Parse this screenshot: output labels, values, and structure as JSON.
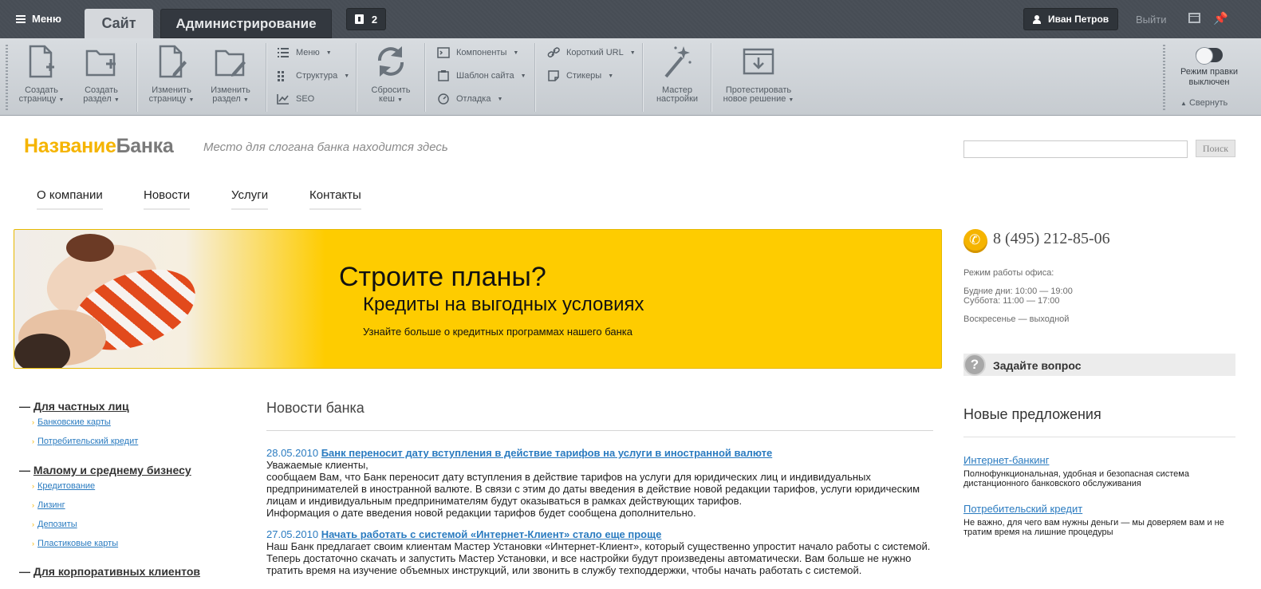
{
  "admin_bar": {
    "menu_label": "Меню",
    "tab_site": "Сайт",
    "tab_admin": "Администрирование",
    "notifications_count": "2",
    "user_name": "Иван Петров",
    "logout": "Выйти"
  },
  "toolbar": {
    "create_page": [
      "Создать",
      "страницу"
    ],
    "create_section": [
      "Создать",
      "раздел"
    ],
    "edit_page": [
      "Изменить",
      "страницу"
    ],
    "edit_section": [
      "Изменить",
      "раздел"
    ],
    "menu": "Меню",
    "structure": "Структура",
    "seo": "SEO",
    "reset_cache": [
      "Сбросить",
      "кеш"
    ],
    "components": "Компоненты",
    "site_template": "Шаблон сайта",
    "debug": "Отладка",
    "short_url": "Короткий URL",
    "stickers": "Стикеры",
    "wizard": [
      "Мастер",
      "настройки"
    ],
    "test_solution": [
      "Протестировать",
      "новое решение"
    ],
    "edit_mode": [
      "Режим правки",
      "выключен"
    ],
    "collapse": "Свернуть"
  },
  "site": {
    "logo_part1": "Название",
    "logo_part2": "Банка",
    "slogan": "Место для слогана банка находится здесь",
    "search_button": "Поиск",
    "nav": [
      "О компании",
      "Новости",
      "Услуги",
      "Контакты"
    ]
  },
  "banner": {
    "title": "Строите планы?",
    "subtitle": "Кредиты на выгодных условиях",
    "description": "Узнайте больше о кредитных программах нашего банка"
  },
  "contacts": {
    "phone": "8 (495) 212-85-06",
    "hours_title": "Режим работы офиса:",
    "weekdays": "Будние дни: 10:00 — 19:00",
    "saturday": "Суббота: 11:00 — 17:00",
    "sunday": "Воскресенье — выходной",
    "ask_question": "Задайте вопрос"
  },
  "offers": {
    "title": "Новые предложения",
    "items": [
      {
        "title": "Интернет-банкинг",
        "desc": "Полнофункциональная, удобная и безопасная система дистанционного банковского обслуживания"
      },
      {
        "title": "Потребительский кредит",
        "desc": "Не важно, для чего вам нужны деньги — мы доверяем вам и не тратим время на лишние процедуры"
      }
    ]
  },
  "left_menu": [
    {
      "title": "Для частных лиц",
      "items": [
        "Банковские карты",
        "Потребительский кредит"
      ]
    },
    {
      "title": "Малому и среднему бизнесу",
      "items": [
        "Кредитование",
        "Лизинг",
        "Депозиты",
        "Пластиковые карты"
      ]
    },
    {
      "title": "Для корпоративных клиентов",
      "items": []
    }
  ],
  "news": {
    "title": "Новости банка",
    "items": [
      {
        "date": "28.05.2010",
        "title": "Банк переносит дату вступления в действие тарифов на услуги в иностранной валюте",
        "text": [
          "Уважаемые клиенты,",
          "сообщаем Вам, что Банк переносит дату вступления в действие тарифов на услуги для юридических лиц и индивидуальных предпринимателей в иностранной валюте. В связи с этим до даты введения в действие новой редакции тарифов, услуги юридическим лицам и индивидуальным предпринимателям будут оказываться в рамках действующих тарифов.",
          "Информация о дате введения новой редакции тарифов будет сообщена дополнительно."
        ]
      },
      {
        "date": "27.05.2010",
        "title": "Начать работать с системой «Интернет-Клиент» стало еще проще",
        "text": [
          "Наш Банк предлагает своим клиентам Мастер Установки «Интернет-Клиент», который существенно упростит начало работы с системой. Теперь достаточно скачать и запустить Мастер Установки, и все настройки будут произведены автоматически. Вам больше не нужно тратить время на изучение объемных инструкций, или звонить в службу техподдержки, чтобы начать работать с системой."
        ]
      }
    ]
  },
  "colors": {
    "brand_yellow": "#fecc00",
    "link_blue": "#2a7bc0",
    "admin_dark": "#474d55"
  }
}
